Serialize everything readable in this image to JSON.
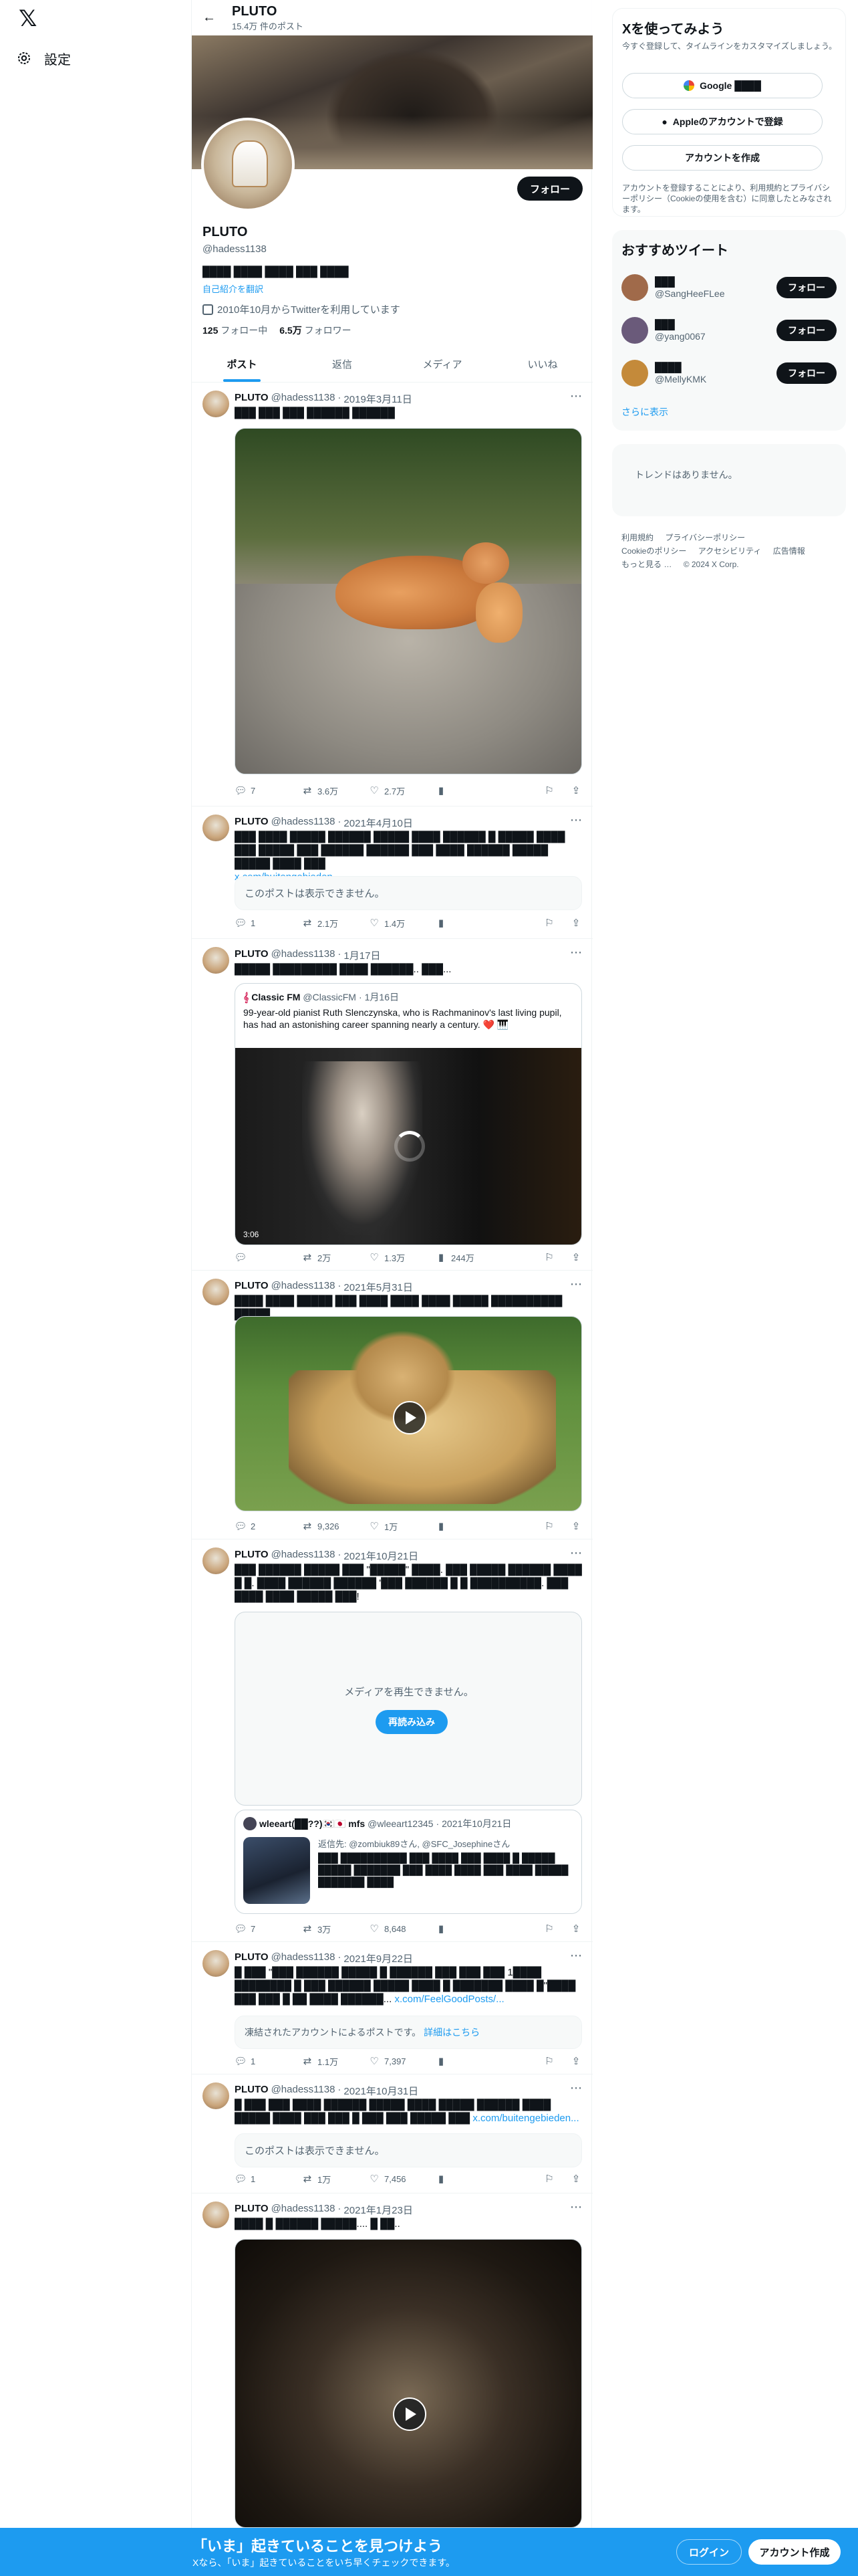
{
  "nav": {
    "settings_label": "設定"
  },
  "header": {
    "name": "PLUTO",
    "post_count": "15.4万 件のポスト"
  },
  "profile": {
    "name": "PLUTO",
    "handle": "@hadess1138",
    "bio": "████ ████ ████ ███ ████",
    "translate": "自己紹介を翻訳",
    "joined": "2010年10月からTwitterを利用しています",
    "following_count": "125",
    "following_label": "フォロー中",
    "followers_count": "6.5万",
    "followers_label": "フォロワー",
    "follow_label": "フォロー"
  },
  "tabs": [
    "ポスト",
    "返信",
    "メディア",
    "いいね"
  ],
  "tweets": [
    {
      "name": "PLUTO",
      "handle": "@hadess1138",
      "date": "2019年3月11日",
      "text": "███ ███ ███ ██████ ██████",
      "replies": "7",
      "retweets": "3.6万",
      "likes": "2.7万"
    },
    {
      "name": "PLUTO",
      "handle": "@hadess1138",
      "date": "2021年4月10日",
      "text": "███ ████ █████ ██████ █████ ████ ██████ █ █████ ████ ███ █████ ███ ██████ ██████ ███ ████ ██████ █████ █████ ████ ███",
      "link": "x.com/buitengebieden...",
      "notice": "このポストは表示できません。",
      "replies": "1",
      "retweets": "2.1万",
      "likes": "1.4万"
    },
    {
      "name": "PLUTO",
      "handle": "@hadess1138",
      "date": "1月17日",
      "text": "█████ █████████ ████ ██████.. ███...",
      "quote_name": "Classic FM",
      "quote_handle": "@ClassicFM",
      "quote_date": "1月16日",
      "quote_text": "99-year-old pianist Ruth Slenczynska, who is Rachmaninov's last living pupil, has had an astonishing career spanning nearly a century. ❤️ 🎹",
      "duration": "3:06",
      "replies": "",
      "retweets": "2万",
      "likes": "1.3万",
      "views": "244万"
    },
    {
      "name": "PLUTO",
      "handle": "@hadess1138",
      "date": "2021年5月31日",
      "text": "████ ████ █████ ███ ████ ████ ████ █████ ██████████ █████",
      "replies": "2",
      "retweets": "9,326",
      "likes": "1万"
    },
    {
      "name": "PLUTO",
      "handle": "@hadess1138",
      "date": "2021年10月21日",
      "text": "███ ██████ █████ ███ \"█████\" ████. ███ █████ ██████ ████ █ █. ████ ██████ ██████ '███ ██████ █ █ ██████████. ███ ████ ████ █████ ███!",
      "media_notice": "メディアを再生できません。",
      "reload_label": "再読み込み",
      "quote_name": "wleeart(██??)🇰🇷🇯🇵 mfs",
      "quote_handle": "@wleeart12345",
      "quote_date": "2021年10月21日",
      "quote_reply": "返信先: @zombiuk89さん, @SFC_Josephineさん",
      "quote_text": "███ ██████████ ███ ████ ███ ████ █ █████ █████ ███████ ███ ████ ████ ███ ████ █████ ███████ ████",
      "replies": "7",
      "retweets": "3万",
      "likes": "8,648"
    },
    {
      "name": "PLUTO",
      "handle": "@hadess1138",
      "date": "2021年9月22日",
      "text": "█ ███ \"███ ██████ █████ █ ██████ ███ ███ ███ 1████ ████████ █ ███ ██████ █████ ████ █ ███████ ████ █\"████ ███ ███ █ ██ ████ ██████...",
      "link": "x.com/FeelGoodPosts/...",
      "notice": "凍結されたアカウントによるポストです。",
      "notice_link": "詳細はこちら",
      "replies": "1",
      "retweets": "1.1万",
      "likes": "7,397"
    },
    {
      "name": "PLUTO",
      "handle": "@hadess1138",
      "date": "2021年10月31日",
      "text": "█ ███ ███ ████ ██████ █████ ████ █████ ██████ ████ █████ ████ ███ ███ █ ███ ███ █████ ███",
      "link": "x.com/buitengebieden...",
      "notice": "このポストは表示できません。",
      "replies": "1",
      "retweets": "1万",
      "likes": "7,456"
    },
    {
      "name": "PLUTO",
      "handle": "@hadess1138",
      "date": "2021年1月23日",
      "text": "████ █ ██████ █████.... █ ██.."
    }
  ],
  "right": {
    "signup_title": "Xを使ってみよう",
    "signup_sub": "今すぐ登録して、タイムラインをカスタマイズしましょう。",
    "google_label": "Google ████",
    "apple_label": "Appleのアカウントで登録",
    "create_label": "アカウントを作成",
    "terms": "アカウントを登録することにより、利用規約とプライバシーポリシー（Cookieの使用を含む）に同意したとみなされます。",
    "rec_title": "おすすめツイート",
    "recs": [
      {
        "name": "███",
        "handle": "@SangHeeFLee",
        "color": "#a06a4a"
      },
      {
        "name": "███",
        "handle": "@yang0067",
        "color": "#6a5a7a"
      },
      {
        "name": "████",
        "handle": "@MellyKMK",
        "color": "#c48a3a"
      }
    ],
    "rec_follow": "フォロー",
    "show_more": "さらに表示",
    "trend_empty": "トレンドはありません。",
    "footer": [
      "利用規約",
      "プライバシーポリシー",
      "Cookieのポリシー",
      "アクセシビリティ",
      "広告情報",
      "もっと見る …",
      "© 2024 X Corp."
    ]
  },
  "bottom": {
    "title": "「いま」起きていることを見つけよう",
    "sub": "Xなら、「いま」起きていることをいち早くチェックできます。",
    "login": "ログイン",
    "signup": "アカウント作成"
  },
  "colors": {
    "accent": "#1d9bf0",
    "text": "#0f1419",
    "muted": "#536471"
  }
}
